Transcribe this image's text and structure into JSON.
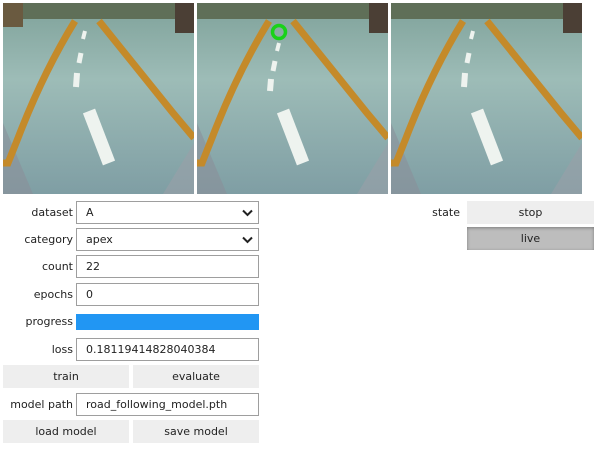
{
  "cameras": [
    {
      "name": "camera-image-1",
      "has_target": false
    },
    {
      "name": "camera-image-2",
      "has_target": true,
      "target_color": "#19d219"
    },
    {
      "name": "camera-image-3",
      "has_target": false
    }
  ],
  "form": {
    "dataset": {
      "label": "dataset",
      "value": "A"
    },
    "category": {
      "label": "category",
      "value": "apex"
    },
    "count": {
      "label": "count",
      "value": "22"
    },
    "epochs": {
      "label": "epochs",
      "value": "0"
    },
    "progress": {
      "label": "progress",
      "value": 1.0,
      "color": "#2196f3"
    },
    "loss": {
      "label": "loss",
      "value": "0.18119414828040384"
    },
    "model_path": {
      "label": "model path",
      "value": "road_following_model.pth"
    }
  },
  "buttons": {
    "train": "train",
    "evaluate": "evaluate",
    "load_model": "load model",
    "save_model": "save model"
  },
  "state": {
    "label": "state",
    "options": [
      "stop",
      "live"
    ],
    "selected": "live"
  }
}
